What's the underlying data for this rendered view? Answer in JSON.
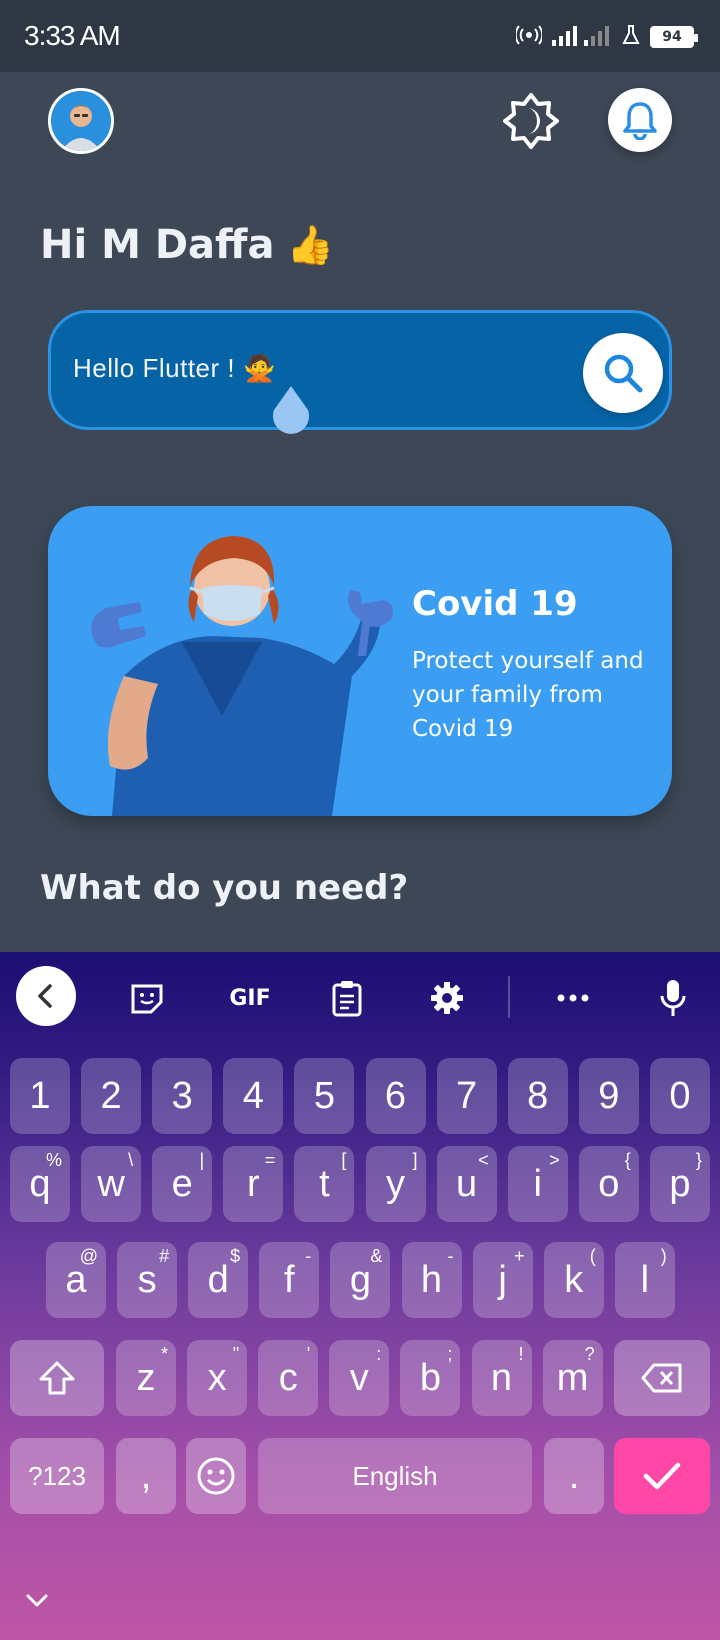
{
  "status_bar": {
    "time": "3:33 AM",
    "battery": "94"
  },
  "header": {
    "avatar_icon": "user-avatar",
    "theme_icon": "brightness-icon",
    "bell_icon": "bell-icon"
  },
  "greeting": {
    "text": "Hi M Daffa",
    "emoji": "👍"
  },
  "search": {
    "value": "Hello Flutter !",
    "emoji": "🙅",
    "icon": "search-icon"
  },
  "card": {
    "title": "Covid 19",
    "description": "Protect yourself and your family from Covid 19",
    "image": "nurse-with-mask-thumbs-down"
  },
  "section": {
    "title": "What do you need?"
  },
  "keyboard": {
    "toolbar": {
      "gif": "GIF"
    },
    "row1": [
      "1",
      "2",
      "3",
      "4",
      "5",
      "6",
      "7",
      "8",
      "9",
      "0"
    ],
    "row2": [
      {
        "k": "q",
        "s": "%"
      },
      {
        "k": "w",
        "s": "\\"
      },
      {
        "k": "e",
        "s": "|"
      },
      {
        "k": "r",
        "s": "="
      },
      {
        "k": "t",
        "s": "["
      },
      {
        "k": "y",
        "s": "]"
      },
      {
        "k": "u",
        "s": "<"
      },
      {
        "k": "i",
        "s": ">"
      },
      {
        "k": "o",
        "s": "{"
      },
      {
        "k": "p",
        "s": "}"
      }
    ],
    "row3": [
      {
        "k": "a",
        "s": "@"
      },
      {
        "k": "s",
        "s": "#"
      },
      {
        "k": "d",
        "s": "$"
      },
      {
        "k": "f",
        "s": "-"
      },
      {
        "k": "g",
        "s": "&"
      },
      {
        "k": "h",
        "s": "-"
      },
      {
        "k": "j",
        "s": "+"
      },
      {
        "k": "k",
        "s": "("
      },
      {
        "k": "l",
        "s": ")"
      }
    ],
    "row4": [
      {
        "k": "z",
        "s": "*"
      },
      {
        "k": "x",
        "s": "\""
      },
      {
        "k": "c",
        "s": "'"
      },
      {
        "k": "v",
        "s": ":"
      },
      {
        "k": "b",
        "s": ";"
      },
      {
        "k": "n",
        "s": "!"
      },
      {
        "k": "m",
        "s": "?"
      }
    ],
    "symbols_label": "?123",
    "comma": ",",
    "space_label": "English",
    "period": ".",
    "accent_color": "#ff47a8"
  }
}
